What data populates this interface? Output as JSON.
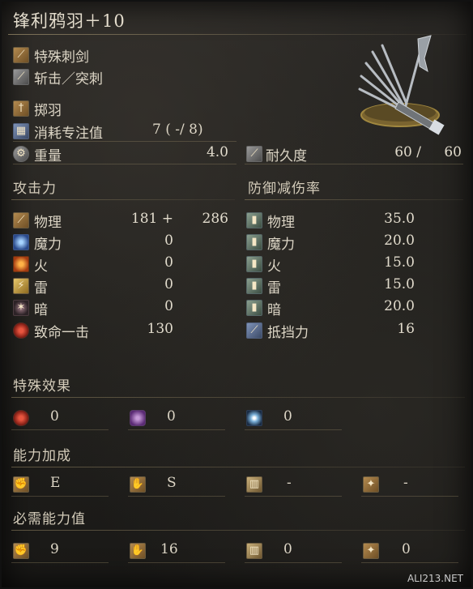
{
  "title": "锋利鸦羽＋10",
  "weapon_type": "特殊刺剑",
  "attack_type": "斩击／突刺",
  "skill": "掷羽",
  "fp_cost": {
    "label": "消耗专注值",
    "value": "7 (  -/ 8)"
  },
  "weight": {
    "label": "重量",
    "value": "4.0"
  },
  "durability": {
    "label": "耐久度",
    "current": "60 /",
    "max": "60"
  },
  "attack_header": "攻击力",
  "defense_header": "防御减伤率",
  "attack": [
    {
      "label": "物理",
      "value": "181 +",
      "bonus": "286",
      "icon": "physical-icon"
    },
    {
      "label": "魔力",
      "value": "0",
      "icon": "magic-icon"
    },
    {
      "label": "火",
      "value": "0",
      "icon": "fire-icon"
    },
    {
      "label": "雷",
      "value": "0",
      "icon": "lightning-icon"
    },
    {
      "label": "暗",
      "value": "0",
      "icon": "dark-icon"
    },
    {
      "label": "致命一击",
      "value": "130",
      "icon": "critical-icon"
    }
  ],
  "defense": [
    {
      "label": "物理",
      "value": "35.0",
      "icon": "physical-def-icon"
    },
    {
      "label": "魔力",
      "value": "20.0",
      "icon": "magic-def-icon"
    },
    {
      "label": "火",
      "value": "15.0",
      "icon": "fire-def-icon"
    },
    {
      "label": "雷",
      "value": "15.0",
      "icon": "lightning-def-icon"
    },
    {
      "label": "暗",
      "value": "20.0",
      "icon": "dark-def-icon"
    },
    {
      "label": "抵挡力",
      "value": "16",
      "icon": "stability-icon"
    }
  ],
  "special_header": "特殊效果",
  "special": [
    {
      "value": "0",
      "icon": "bleed-icon"
    },
    {
      "value": "0",
      "icon": "poison-icon"
    },
    {
      "value": "0",
      "icon": "frost-icon"
    }
  ],
  "scaling_header": "能力加成",
  "scaling": [
    {
      "value": "E",
      "icon": "strength-icon"
    },
    {
      "value": "S",
      "icon": "dexterity-icon"
    },
    {
      "value": "-",
      "icon": "intelligence-icon"
    },
    {
      "value": "-",
      "icon": "faith-icon"
    }
  ],
  "requirements_header": "必需能力值",
  "requirements": [
    {
      "value": "9",
      "icon": "strength-req-icon"
    },
    {
      "value": "16",
      "icon": "dexterity-req-icon"
    },
    {
      "value": "0",
      "icon": "intelligence-req-icon"
    },
    {
      "value": "0",
      "icon": "faith-req-icon"
    }
  ],
  "watermark": "ALI213.NET"
}
